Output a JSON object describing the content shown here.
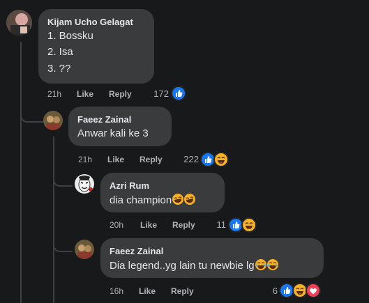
{
  "comments": [
    {
      "author": "Kijam Ucho Gelagat",
      "lines": [
        "1. Bossku",
        "2. Isa",
        "3. ??"
      ],
      "time": "21h",
      "like": "Like",
      "reply": "Reply",
      "reactions": "172",
      "reaction_icons": [
        "like-icon"
      ]
    },
    {
      "author": "Faeez Zainal",
      "text": "Anwar kali ke 3",
      "time": "21h",
      "like": "Like",
      "reply": "Reply",
      "reactions": "222",
      "reaction_icons": [
        "like-icon",
        "haha-icon"
      ]
    },
    {
      "author": "Azri Rum",
      "text": "dia champion",
      "emojis": [
        "rofl-emoji",
        "rofl-emoji"
      ],
      "time": "20h",
      "like": "Like",
      "reply": "Reply",
      "reactions": "11",
      "reaction_icons": [
        "like-icon",
        "haha-icon"
      ]
    },
    {
      "author": "Faeez Zainal",
      "text": "Dia legend..yg lain tu newbie lg",
      "emojis": [
        "joy-emoji",
        "joy-emoji"
      ],
      "time": "16h",
      "like": "Like",
      "reply": "Reply",
      "reactions": "6",
      "reaction_icons": [
        "like-icon",
        "haha-icon",
        "love-icon"
      ]
    }
  ],
  "colors": {
    "background": "#18191a",
    "bubble": "#3a3b3c",
    "like": "#1877f2",
    "haha": "#f7b125",
    "love": "#f33e58"
  }
}
